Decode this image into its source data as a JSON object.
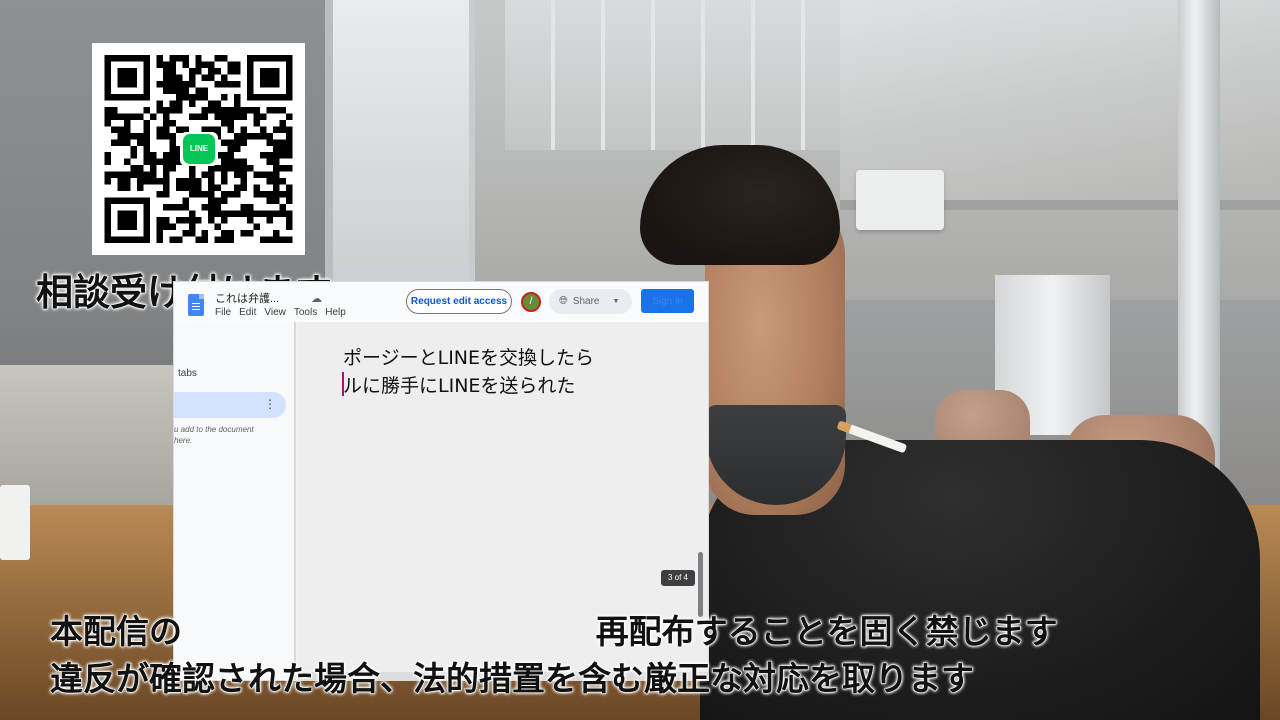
{
  "qr_code": {
    "badge_text": "LINE",
    "brand_color": "#06c755"
  },
  "captions": {
    "top": "相談受け付けます",
    "line1": "本配信の                                    再配布することを固く禁じます",
    "line2": "違反が確認された場合、法的措置を含む厳正な対応を取ります"
  },
  "doc": {
    "title": "これは弁護...",
    "cloud_icon": "cloud-icon",
    "menu": [
      "File",
      "Edit",
      "View",
      "Tools",
      "Help"
    ],
    "request_button": "Request edit access",
    "avatar_letter": "/",
    "share_label": "Share",
    "signin_label": "Sign in",
    "sidebar": {
      "tabs_label": "tabs",
      "hint": "u add to the document\nhere."
    },
    "content": {
      "line1": "ポージーとLINEを交換したら",
      "line2": "ルに勝手にLINEを送られた"
    },
    "page_indicator": "3 of 4",
    "accent_color": "#1a73e8"
  }
}
